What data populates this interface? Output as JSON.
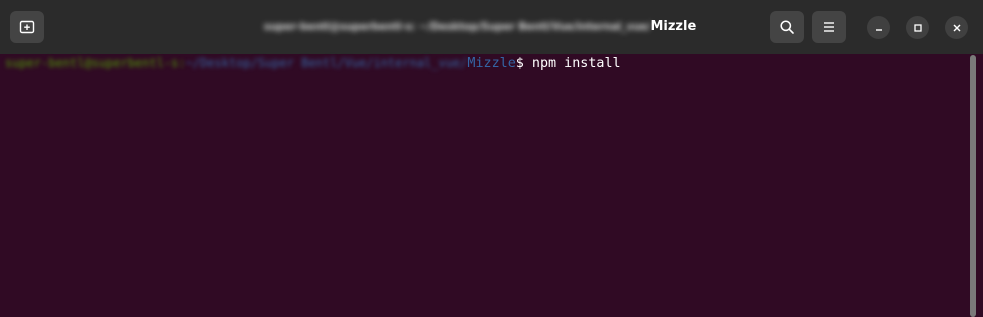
{
  "window": {
    "title_blurred": "super-bentl@superbentl-s: ~/Desktop/Super Bentl/Vue/internal_vue/",
    "title_dir": "Mizzle"
  },
  "icons": {
    "new_tab": "new-tab-icon",
    "search": "search-icon",
    "menu": "hamburger-menu-icon",
    "minimize": "minimize-icon",
    "maximize": "maximize-icon",
    "close": "close-icon"
  },
  "terminal": {
    "prompt_user_host": "super-bentl@superbentl-s",
    "prompt_separator": ":",
    "prompt_path_blurred": "~/Desktop/Super Bentl/Vue/internal_vue/",
    "prompt_dir": "Mizzle",
    "prompt_symbol": "$ ",
    "command": "npm install"
  },
  "colors": {
    "terminal_bg": "#300a24",
    "titlebar_bg": "#2b2b2b",
    "prompt_user": "#4e9a06",
    "prompt_path": "#3465a4"
  }
}
